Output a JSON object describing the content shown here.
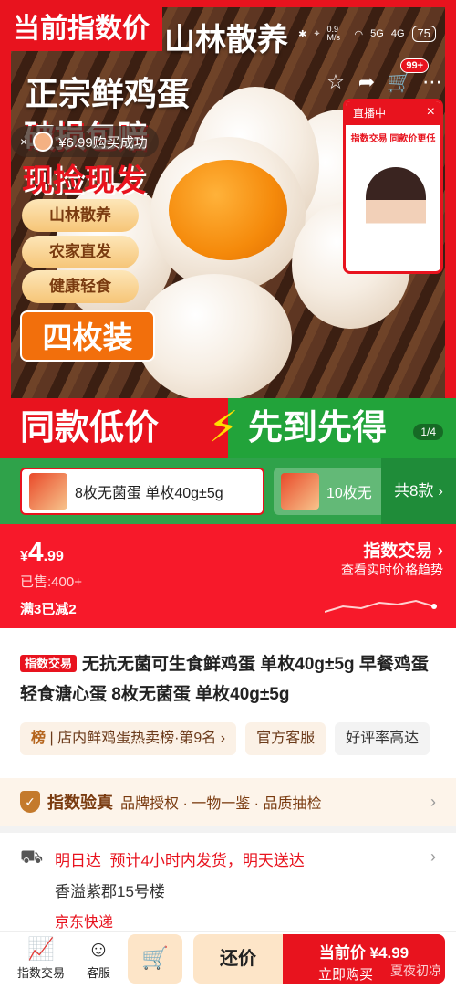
{
  "status_bar": {
    "signal": "5G",
    "signal2": "4G",
    "speed": "0.9\nM/s",
    "battery": "75"
  },
  "index_banner": "当前指数价",
  "hero": {
    "headline1": "山林散养",
    "headline2": "正宗鲜鸡蛋",
    "slogan1": "破损包赔",
    "slogan2": "现捡现发",
    "tags": [
      "山林散养",
      "农家直发",
      "健康轻食"
    ],
    "pack": "四枚装",
    "cart_badge": "99+",
    "pager": "1/4"
  },
  "toast": {
    "text": "¥6.99购买成功"
  },
  "live": {
    "label": "直播中",
    "subtitle": "指数交易 同款价更低"
  },
  "promo": {
    "left": "同款低价",
    "right": "先到先得"
  },
  "variants": {
    "selected": "8枚无菌蛋 单枚40g±5g",
    "other": "10枚无",
    "more": "共8款"
  },
  "price": {
    "currency": "¥",
    "integer": "4",
    "decimal": ".99",
    "sold": "已售:400+",
    "promo": "满3已减2",
    "index_trade": "指数交易",
    "trend_link": "查看实时价格趋势"
  },
  "title": {
    "badge": "指数交易",
    "text": "无抗无菌可生食鲜鸡蛋 单枚40g±5g 早餐鸡蛋 轻食溏心蛋 8枚无菌蛋 单枚40g±5g"
  },
  "chips": {
    "rank_icon": "榜",
    "rank": "店内鲜鸡蛋热卖榜·第9名",
    "service": "官方客服",
    "review": "好评率高达"
  },
  "verify": {
    "title": "指数验真",
    "items": "品牌授权 · 一物一鉴 · 品质抽检"
  },
  "shipping": {
    "label": "明日达",
    "eta": "预计4小时内发货，明天送达",
    "address": "香溢紫郡15号楼",
    "courier": "京东快递"
  },
  "bottom": {
    "index_trade": "指数交易",
    "service": "客服",
    "bargain": "还价",
    "price_label": "当前价 ¥4.99",
    "buy": "立即购买",
    "watermark": "夏夜初凉"
  },
  "colors": {
    "brand_red": "#e8131e",
    "price_red": "#f7192a",
    "promo_green": "#22a33a",
    "tag_gold": "#f6c577"
  }
}
